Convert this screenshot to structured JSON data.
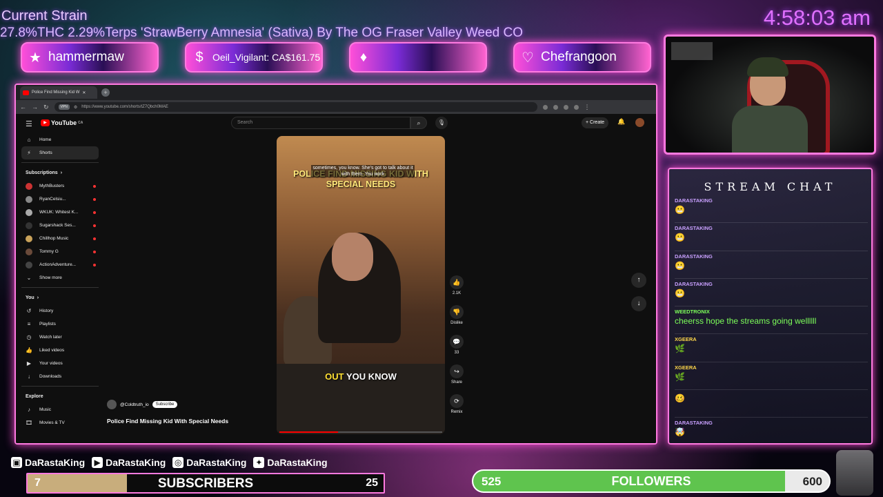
{
  "overlay": {
    "strain_title": "Current Strain",
    "strain_info": "27.8%THC 2.29%Terps 'StrawBerry Amnesia' (Sativa) By The OG Fraser Valley Weed CO",
    "clock": "4:58:03 am",
    "alerts": [
      {
        "icon": "star-icon",
        "glyph": "★",
        "name": "hammermaw"
      },
      {
        "icon": "dollar-icon",
        "glyph": "$",
        "name": "Oeil_Vigilant: CA$161.75"
      },
      {
        "icon": "diamond-icon",
        "glyph": "♦",
        "name": ""
      },
      {
        "icon": "heart-icon",
        "glyph": "♡",
        "name": "Chefrangoon"
      }
    ]
  },
  "browser": {
    "tab_title": "Police Find Missing Kid W",
    "url": "https://www.youtube.com/shorts/tZ7Qbch0MAE",
    "vpn": "VPN"
  },
  "youtube": {
    "logo": "YouTube",
    "logo_region": "CA",
    "search_placeholder": "Search",
    "create_label": "Create",
    "nav": [
      {
        "icon": "home-icon",
        "glyph": "⌂",
        "label": "Home"
      },
      {
        "icon": "shorts-icon",
        "glyph": "⚡",
        "label": "Shorts"
      }
    ],
    "subscriptions_title": "Subscriptions",
    "subscriptions": [
      {
        "label": "MythBusters",
        "color": "#c33"
      },
      {
        "label": "RyanCelsiu...",
        "color": "#888"
      },
      {
        "label": "WKUK: Whitest K...",
        "color": "#aaa"
      },
      {
        "label": "Sugarshack Ses...",
        "color": "#333"
      },
      {
        "label": "Chillhop Music",
        "color": "#c9a25a"
      },
      {
        "label": "Tommy G",
        "color": "#6a4a3a"
      },
      {
        "label": "ActionAdventure...",
        "color": "#444"
      }
    ],
    "show_more": "Show more",
    "you_title": "You",
    "you_items": [
      {
        "icon": "history-icon",
        "glyph": "↺",
        "label": "History"
      },
      {
        "icon": "playlists-icon",
        "glyph": "≡",
        "label": "Playlists"
      },
      {
        "icon": "watch-later-icon",
        "glyph": "◷",
        "label": "Watch later"
      },
      {
        "icon": "liked-icon",
        "glyph": "👍",
        "label": "Liked videos"
      },
      {
        "icon": "your-videos-icon",
        "glyph": "▶",
        "label": "Your videos"
      },
      {
        "icon": "downloads-icon",
        "glyph": "↓",
        "label": "Downloads"
      }
    ],
    "explore_title": "Explore",
    "explore_items": [
      {
        "icon": "music-icon",
        "glyph": "♪",
        "label": "Music"
      },
      {
        "icon": "movies-icon",
        "glyph": "🎞",
        "label": "Movies & TV"
      }
    ],
    "short": {
      "subtitle": "sometimes, you know. She's got to talk about it with them. You work",
      "title_overlay": "POLICE FIND MISSING KID WITH SPECIAL NEEDS",
      "caption_hl": "OUT",
      "caption_rest": " YOU KNOW",
      "progress": 0.36,
      "channel": "@Coldtruth_io",
      "subscribe": "Subscribe",
      "title": "Police Find Missing Kid With Special Needs"
    },
    "actions": [
      {
        "icon": "like-icon",
        "glyph": "👍",
        "label": "2.1K"
      },
      {
        "icon": "dislike-icon",
        "glyph": "👎",
        "label": "Dislike"
      },
      {
        "icon": "comments-icon",
        "glyph": "💬",
        "label": "33"
      },
      {
        "icon": "share-icon",
        "glyph": "↪",
        "label": "Share"
      },
      {
        "icon": "remix-icon",
        "glyph": "⟳",
        "label": "Remix"
      }
    ]
  },
  "chat": {
    "title": "STREAM CHAT",
    "messages": [
      {
        "user": "DARASTAKING",
        "text": "😬",
        "emote": true,
        "color": "#c9a0ff"
      },
      {
        "user": "DARASTAKING",
        "text": "😬",
        "emote": true,
        "color": "#c9a0ff"
      },
      {
        "user": "DARASTAKING",
        "text": "😬",
        "emote": true,
        "color": "#c9a0ff"
      },
      {
        "user": "DARASTAKING",
        "text": "😬",
        "emote": true,
        "color": "#c9a0ff"
      },
      {
        "user": "WEEDTRONIX",
        "text": "cheerss hope the streams going wellllll",
        "emote": false,
        "color": "#7dff5a"
      },
      {
        "user": "XGEERA",
        "text": "🌿",
        "emote": true,
        "color": "#ffd84a"
      },
      {
        "user": "XGEERA",
        "text": "🌿",
        "emote": true,
        "color": "#ffd84a"
      },
      {
        "user": "",
        "text": "🥴",
        "emote": true,
        "color": "#ff3030"
      },
      {
        "user": "DARASTAKING",
        "text": "🤯",
        "emote": true,
        "color": "#c9a0ff"
      }
    ]
  },
  "bottom": {
    "socials": [
      {
        "icon": "twitch-icon",
        "glyph": "▣",
        "handle": "DaRastaKing"
      },
      {
        "icon": "youtube-icon",
        "glyph": "▶",
        "handle": "DaRastaKing"
      },
      {
        "icon": "instagram-icon",
        "glyph": "◎",
        "handle": "DaRastaKing"
      },
      {
        "icon": "twitter-icon",
        "glyph": "✦",
        "handle": "DaRastaKing"
      }
    ],
    "subscribers": {
      "current": "7",
      "label": "SUBSCRIBERS",
      "goal": "25",
      "progress": 0.28
    },
    "followers": {
      "current": "525",
      "label": "FOLLOWERS",
      "goal": "600",
      "progress": 0.875
    }
  }
}
